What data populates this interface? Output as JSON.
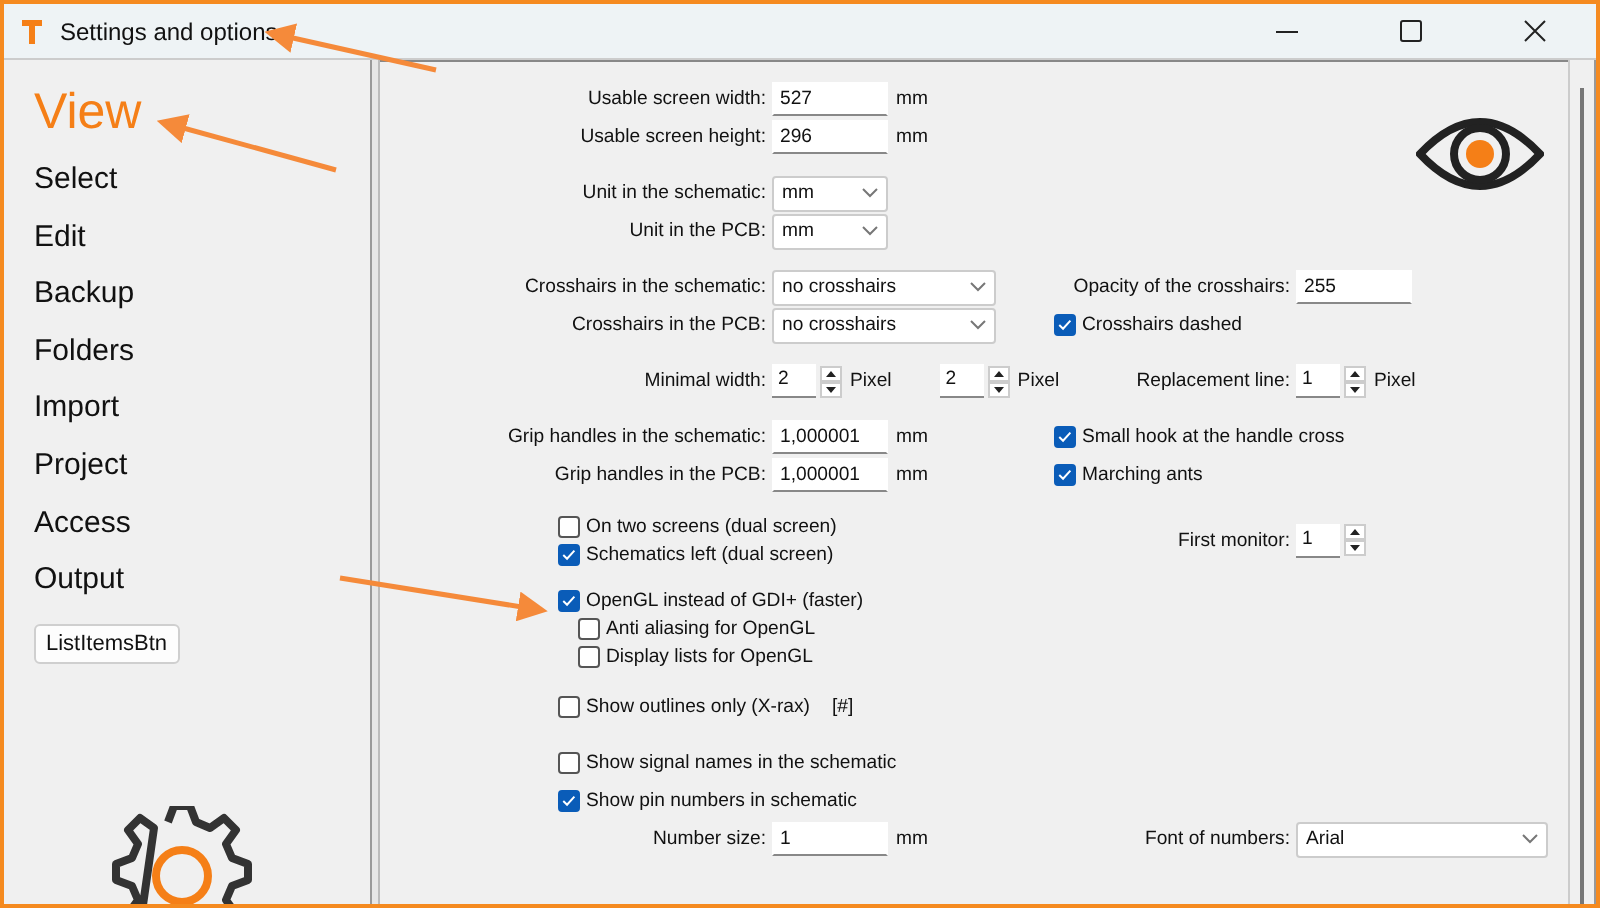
{
  "window": {
    "title": "Settings and options"
  },
  "sidebar": {
    "items": [
      {
        "label": "View",
        "selected": true
      },
      {
        "label": "Select",
        "selected": false
      },
      {
        "label": "Edit",
        "selected": false
      },
      {
        "label": "Backup",
        "selected": false
      },
      {
        "label": "Folders",
        "selected": false
      },
      {
        "label": "Import",
        "selected": false
      },
      {
        "label": "Project",
        "selected": false
      },
      {
        "label": "Access",
        "selected": false
      },
      {
        "label": "Output",
        "selected": false
      }
    ],
    "button": "ListItemsBtn"
  },
  "form": {
    "sections": [
      {
        "rows": [
          {
            "left": [
              {
                "kind": "text",
                "label": "Usable screen width:",
                "value": "527",
                "unit": "mm"
              }
            ]
          },
          {
            "left": [
              {
                "kind": "text",
                "label": "Usable screen height:",
                "value": "296",
                "unit": "mm"
              }
            ]
          }
        ]
      },
      {
        "rows": [
          {
            "left": [
              {
                "kind": "select",
                "label": "Unit in the schematic:",
                "value": "mm"
              }
            ]
          },
          {
            "left": [
              {
                "kind": "select",
                "label": "Unit in the PCB:",
                "value": "mm"
              }
            ]
          }
        ]
      },
      {
        "rows": [
          {
            "left": [
              {
                "kind": "select",
                "label": "Crosshairs in the schematic:",
                "value": "no crosshairs"
              }
            ],
            "right": {
              "kind": "text",
              "label": "Opacity of the crosshairs:",
              "value": "255"
            }
          },
          {
            "left": [
              {
                "kind": "select",
                "label": "Crosshairs in the PCB:",
                "value": "no crosshairs"
              }
            ],
            "right": {
              "kind": "checkbox",
              "label": "Crosshairs dashed",
              "checked": true
            }
          }
        ]
      },
      {
        "rows": [
          {
            "left": [
              {
                "kind": "spin",
                "label": "Minimal width:",
                "value": "2",
                "unit": "Pixel",
                "value_2": "2",
                "unit_2": "Pixel"
              }
            ],
            "right": {
              "kind": "spin",
              "label": "Replacement line:",
              "value": "1",
              "unit": "Pixel"
            }
          }
        ]
      },
      {
        "rows": [
          {
            "left": [
              {
                "kind": "text",
                "label": "Grip handles in the schematic:",
                "value": "1,000001",
                "unit": "mm"
              }
            ],
            "right": {
              "kind": "checkbox",
              "label": "Small hook at the handle cross",
              "checked": true
            }
          },
          {
            "left": [
              {
                "kind": "text",
                "label": "Grip handles in the PCB:",
                "value": "1,000001",
                "unit": "mm"
              }
            ],
            "right": {
              "kind": "checkbox",
              "label": "Marching ants",
              "checked": true
            }
          }
        ]
      },
      {
        "rows": [
          {
            "left": [
              {
                "kind": "checkbox",
                "label": "On two screens (dual screen)",
                "checked": false
              },
              {
                "kind": "checkbox",
                "label": "Schematics left (dual screen)",
                "checked": true
              }
            ],
            "right": {
              "kind": "spin",
              "label": "First monitor:",
              "value": "1"
            }
          }
        ]
      },
      {
        "rows": [
          {
            "left": [
              {
                "kind": "checkbox",
                "label": "OpenGL instead of GDI+ (faster)",
                "checked": true,
                "children": [
                  {
                    "kind": "checkbox",
                    "label": "Anti aliasing for OpenGL",
                    "checked": false
                  },
                  {
                    "kind": "checkbox",
                    "label": "Display lists for OpenGL",
                    "checked": false
                  }
                ]
              }
            ]
          }
        ]
      },
      {
        "rows": [
          {
            "left": [
              {
                "kind": "checkbox",
                "label": "Show outlines only (X-rax)",
                "checked": false,
                "note": "[#]"
              }
            ]
          }
        ]
      },
      {
        "rows": [
          {
            "left": [
              {
                "kind": "checkbox",
                "label": "Show signal names in the schematic",
                "checked": false
              }
            ]
          },
          {
            "left": [
              {
                "kind": "checkbox",
                "label": "Show pin numbers in schematic",
                "checked": true
              }
            ]
          },
          {
            "left": [
              {
                "kind": "text",
                "label": "Number size:",
                "value": "1",
                "unit": "mm"
              }
            ],
            "right": {
              "kind": "select",
              "label": "Font of numbers:",
              "value": "Arial"
            }
          }
        ]
      }
    ]
  }
}
